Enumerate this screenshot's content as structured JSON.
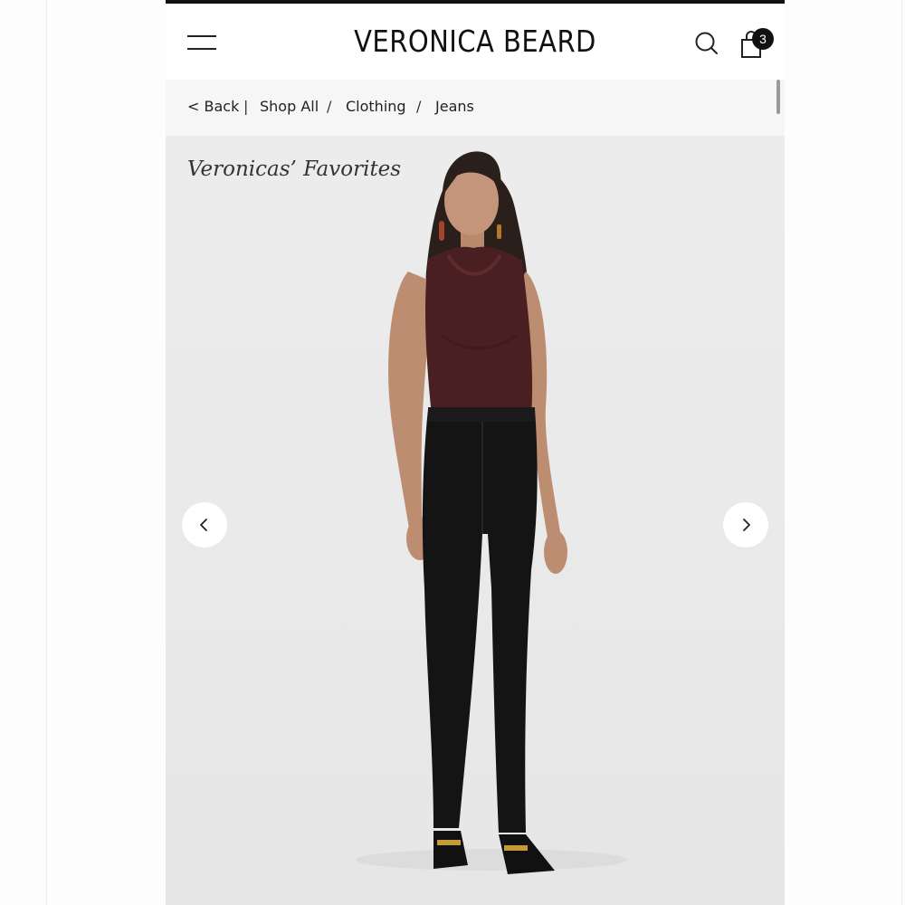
{
  "header": {
    "brand": "VERONICA BEARD",
    "bag_count": "3",
    "icons": [
      "menu-icon",
      "search-icon",
      "shopping-bag-icon"
    ]
  },
  "breadcrumb": {
    "back": "< Back",
    "divider": "|",
    "items": [
      "Shop All",
      "Clothing",
      "Jeans"
    ],
    "separator": "/"
  },
  "hero": {
    "label": "Veronicas’ Favorites",
    "prev_icon": "chevron-left-icon",
    "next_icon": "chevron-right-icon"
  },
  "colors": {
    "top_bar": "#111111",
    "breadcrumb_bg": "#f6f6f6",
    "hero_bg": "#ececec",
    "top_garment": "#4a1f22",
    "jeans": "#141414"
  }
}
